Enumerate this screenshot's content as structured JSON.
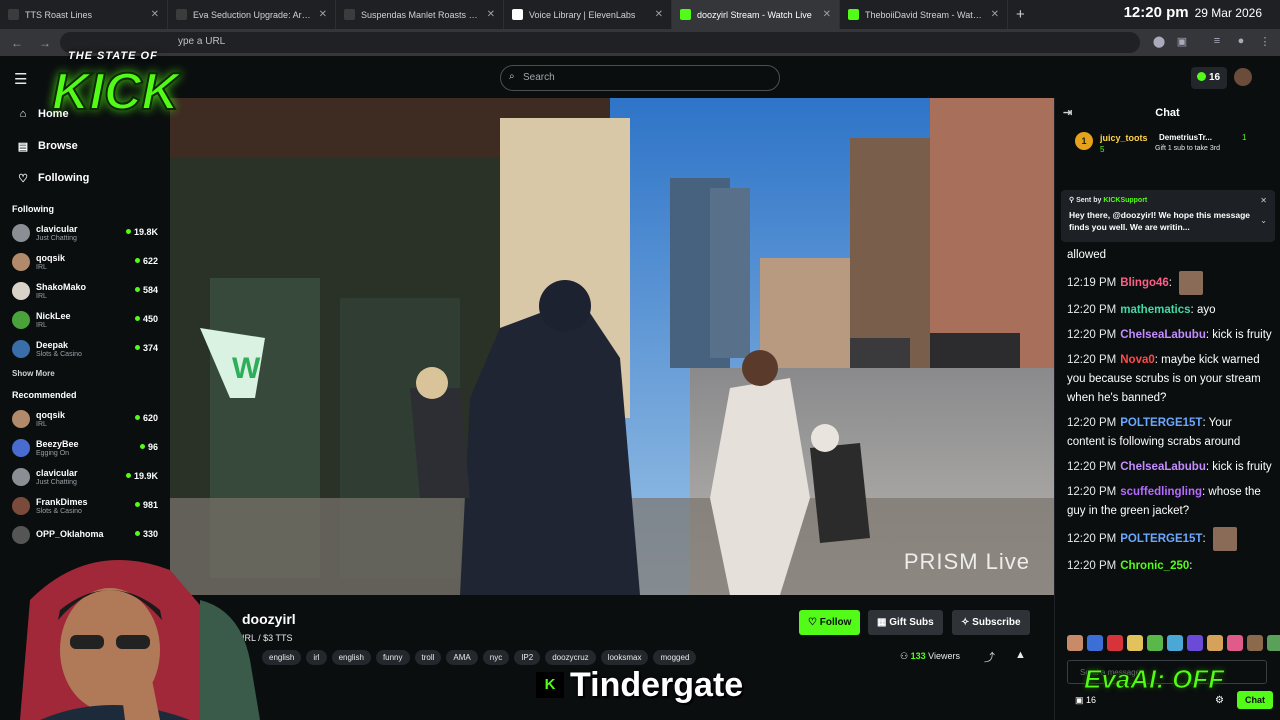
{
  "browser": {
    "tabs": [
      {
        "title": "TTS Roast Lines",
        "fav": "#3c3c3c",
        "active": false
      },
      {
        "title": "Eva Seduction Upgrade: Archety",
        "fav": "#3c3c3c",
        "active": false
      },
      {
        "title": "Suspendas Manlet Roasts & TTS",
        "fav": "#3c3c3c",
        "active": false
      },
      {
        "title": "Voice Library | ElevenLabs",
        "fav": "#ffffff",
        "active": false
      },
      {
        "title": "doozyirl Stream - Watch Live",
        "fav": "#53fc18",
        "active": true
      },
      {
        "title": "TheboiiDavid Stream - Watch Live",
        "fav": "#53fc18",
        "active": false
      }
    ],
    "url_placeholder": "ype a URL",
    "time": "12:20 pm",
    "date": "29 Mar 2026"
  },
  "logo": {
    "line1": "THE STATE OF",
    "line2": "KICK"
  },
  "header": {
    "search_placeholder": "Search",
    "points": "16"
  },
  "sidebar": {
    "nav": [
      {
        "label": "Home",
        "icon": "home-icon"
      },
      {
        "label": "Browse",
        "icon": "browse-icon"
      },
      {
        "label": "Following",
        "icon": "heart-icon"
      }
    ],
    "following_title": "Following",
    "following": [
      {
        "name": "clavicular",
        "cat": "Just Chatting",
        "viewers": "19.8K",
        "color": "#8a8f96"
      },
      {
        "name": "qoqsik",
        "cat": "IRL",
        "viewers": "622",
        "color": "#b08a6a"
      },
      {
        "name": "ShakoMako",
        "cat": "IRL",
        "viewers": "584",
        "color": "#d9d2c8"
      },
      {
        "name": "NickLee",
        "cat": "IRL",
        "viewers": "450",
        "color": "#4aa33a"
      },
      {
        "name": "Deepak",
        "cat": "Slots & Casino",
        "viewers": "374",
        "color": "#3a6ea8"
      }
    ],
    "show_more": "Show More",
    "recommended_title": "Recommended",
    "recommended": [
      {
        "name": "qoqsik",
        "cat": "IRL",
        "viewers": "620",
        "color": "#b08a6a"
      },
      {
        "name": "BeezyBee",
        "cat": "Egging On",
        "viewers": "96",
        "color": "#4a6bd0"
      },
      {
        "name": "clavicular",
        "cat": "Just Chatting",
        "viewers": "19.9K",
        "color": "#8a8f96"
      },
      {
        "name": "FrankDimes",
        "cat": "Slots & Casino",
        "viewers": "981",
        "color": "#7a4a3a"
      },
      {
        "name": "OPP_Oklahoma",
        "cat": "",
        "viewers": "330",
        "color": "#555"
      }
    ]
  },
  "video": {
    "watermark": "PRISM Live"
  },
  "stream": {
    "name": "doozyirl",
    "title": "IRL / $3 TTS",
    "tags": [
      "english",
      "irl",
      "english",
      "funny",
      "troll",
      "AMA",
      "nyc",
      "IP2",
      "doozycruz",
      "looksmax",
      "mogged"
    ],
    "follow": "Follow",
    "gift": "Gift Subs",
    "subscribe": "Subscribe",
    "viewers": "133",
    "viewers_label": "Viewers"
  },
  "overlay": {
    "caption": "Tindergate",
    "evaai": "EvaAI: OFF"
  },
  "chat": {
    "title": "Chat",
    "gifter": {
      "rank": "1",
      "name": "juicy_toots",
      "count": "5",
      "name2": "DemetriusTr...",
      "count2": "1",
      "gift_text": "Gift 1 sub to take 3rd"
    },
    "pinned": {
      "sent_by": "Sent by",
      "sender": "KICKSupport",
      "message": "Hey there, @doozyirl! We hope this message finds you well. We are writin..."
    },
    "messages": [
      {
        "time": "",
        "user": "",
        "color": "#fff",
        "text": "allowed",
        "emote": false
      },
      {
        "time": "12:19 PM",
        "user": "Blingo46",
        "color": "#ff5f8a",
        "text": "",
        "emote": true
      },
      {
        "time": "12:20 PM",
        "user": "mathematics",
        "color": "#43d9a3",
        "text": "ayo",
        "emote": false
      },
      {
        "time": "12:20 PM",
        "user": "ChelseaLabubu",
        "color": "#c48cff",
        "text": "kick is fruity",
        "emote": false
      },
      {
        "time": "12:20 PM",
        "user": "Nova0",
        "color": "#ff4a4a",
        "text": "maybe kick warned you because scrubs is on your stream when he's banned?",
        "emote": false
      },
      {
        "time": "12:20 PM",
        "user": "POLTERGE15T",
        "color": "#6aa8ff",
        "text": "Your content is following scrabs around",
        "emote": false
      },
      {
        "time": "12:20 PM",
        "user": "ChelseaLabubu",
        "color": "#c48cff",
        "text": "kick is fruity",
        "emote": false
      },
      {
        "time": "12:20 PM",
        "user": "scuffedlingling",
        "color": "#b56bff",
        "text": "whose the guy in the green jacket?",
        "emote": false
      },
      {
        "time": "12:20 PM",
        "user": "POLTERGE15T",
        "color": "#6aa8ff",
        "text": "",
        "emote": true
      },
      {
        "time": "12:20 PM",
        "user": "Chronic_250",
        "color": "#53fc18",
        "text": "",
        "emote": false
      }
    ],
    "send_placeholder": "Send a message",
    "points": "16",
    "chat_button": "Chat"
  }
}
